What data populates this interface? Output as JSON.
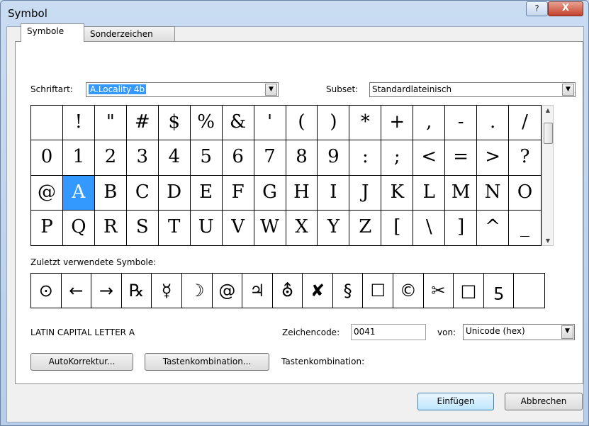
{
  "window": {
    "title": "Symbol",
    "help_label": "?",
    "close_label": "X"
  },
  "tabs": [
    {
      "label": "Symbole",
      "active": true
    },
    {
      "label": "Sonderzeichen",
      "active": false
    }
  ],
  "font": {
    "label": "Schriftart:",
    "value": "A.Locality 4b"
  },
  "subset": {
    "label": "Subset:",
    "value": "Standardlateinisch"
  },
  "symbol_grid": {
    "rows": [
      [
        " ",
        "!",
        "\"",
        "#",
        "$",
        "%",
        "&",
        "'",
        "(",
        ")",
        "*",
        "+",
        ",",
        "-",
        ".",
        "/"
      ],
      [
        "0",
        "1",
        "2",
        "3",
        "4",
        "5",
        "6",
        "7",
        "8",
        "9",
        ":",
        ";",
        "<",
        "=",
        ">",
        "?"
      ],
      [
        "@",
        "A",
        "B",
        "C",
        "D",
        "E",
        "F",
        "G",
        "H",
        "I",
        "J",
        "K",
        "L",
        "M",
        "N",
        "O"
      ],
      [
        "P",
        "Q",
        "R",
        "S",
        "T",
        "U",
        "V",
        "W",
        "X",
        "Y",
        "Z",
        "[",
        "\\",
        "]",
        "^",
        "_"
      ]
    ],
    "selected": "A"
  },
  "recent": {
    "label": "Zuletzt verwendete Symbole:",
    "symbols": [
      "⊙",
      "←",
      "→",
      "℞",
      "☿",
      "☽",
      "@",
      "♃",
      "⛢",
      "✘",
      "§",
      "☐",
      "©",
      "✂",
      "□",
      "ƽ",
      ""
    ]
  },
  "char_name": "LATIN CAPITAL LETTER A",
  "char_code": {
    "label": "Zeichencode:",
    "value": "0041"
  },
  "from": {
    "label": "von:",
    "value": "Unicode (hex)"
  },
  "buttons": {
    "autocorrect": "AutoKorrektur...",
    "shortcut_key": "Tastenkombination...",
    "insert": "Einfügen",
    "cancel": "Abbrechen"
  },
  "shortcut_label": "Tastenkombination:",
  "colors": {
    "selection": "#3399ff",
    "titlebar": "#c9dcf2",
    "close_button": "#c4422d"
  }
}
